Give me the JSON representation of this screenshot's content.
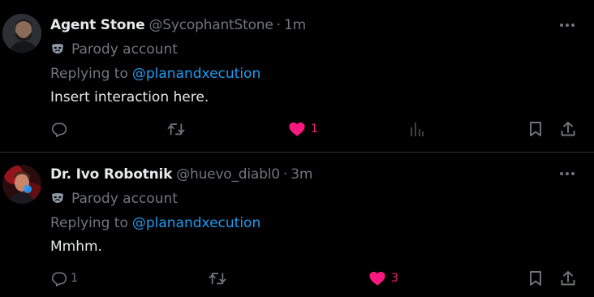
{
  "posts": [
    {
      "display_name": "Agent Stone",
      "handle": "@SycophantStone",
      "separator": "·",
      "time": "1m",
      "parody_label": "Parody account",
      "replying_prefix": "Replying to",
      "replying_to": "@planandxecution",
      "text": "Insert interaction here.",
      "actions": {
        "reply_count": "",
        "repost_count": "",
        "like_count": "1",
        "liked": true,
        "views_count": ""
      },
      "icons": [
        "parody-mask-icon",
        "reply-icon",
        "repost-icon",
        "like-icon",
        "views-icon",
        "bookmark-icon",
        "share-icon",
        "more-icon"
      ]
    },
    {
      "display_name": "Dr. Ivo Robotnik",
      "handle": "@huevo_diabl0",
      "separator": "·",
      "time": "3m",
      "parody_label": "Parody account",
      "replying_prefix": "Replying to",
      "replying_to": "@planandxecution",
      "text": "Mmhm.",
      "actions": {
        "reply_count": "1",
        "repost_count": "",
        "like_count": "3",
        "liked": true
      },
      "icons": [
        "parody-mask-icon",
        "reply-icon",
        "repost-icon",
        "like-icon",
        "bookmark-icon",
        "share-icon",
        "more-icon"
      ]
    }
  ],
  "colors": {
    "background": "#000000",
    "text": "#e7e9ea",
    "secondary": "#71767b",
    "link": "#1d9bf0",
    "like": "#f91880",
    "divider": "#2f3336"
  }
}
